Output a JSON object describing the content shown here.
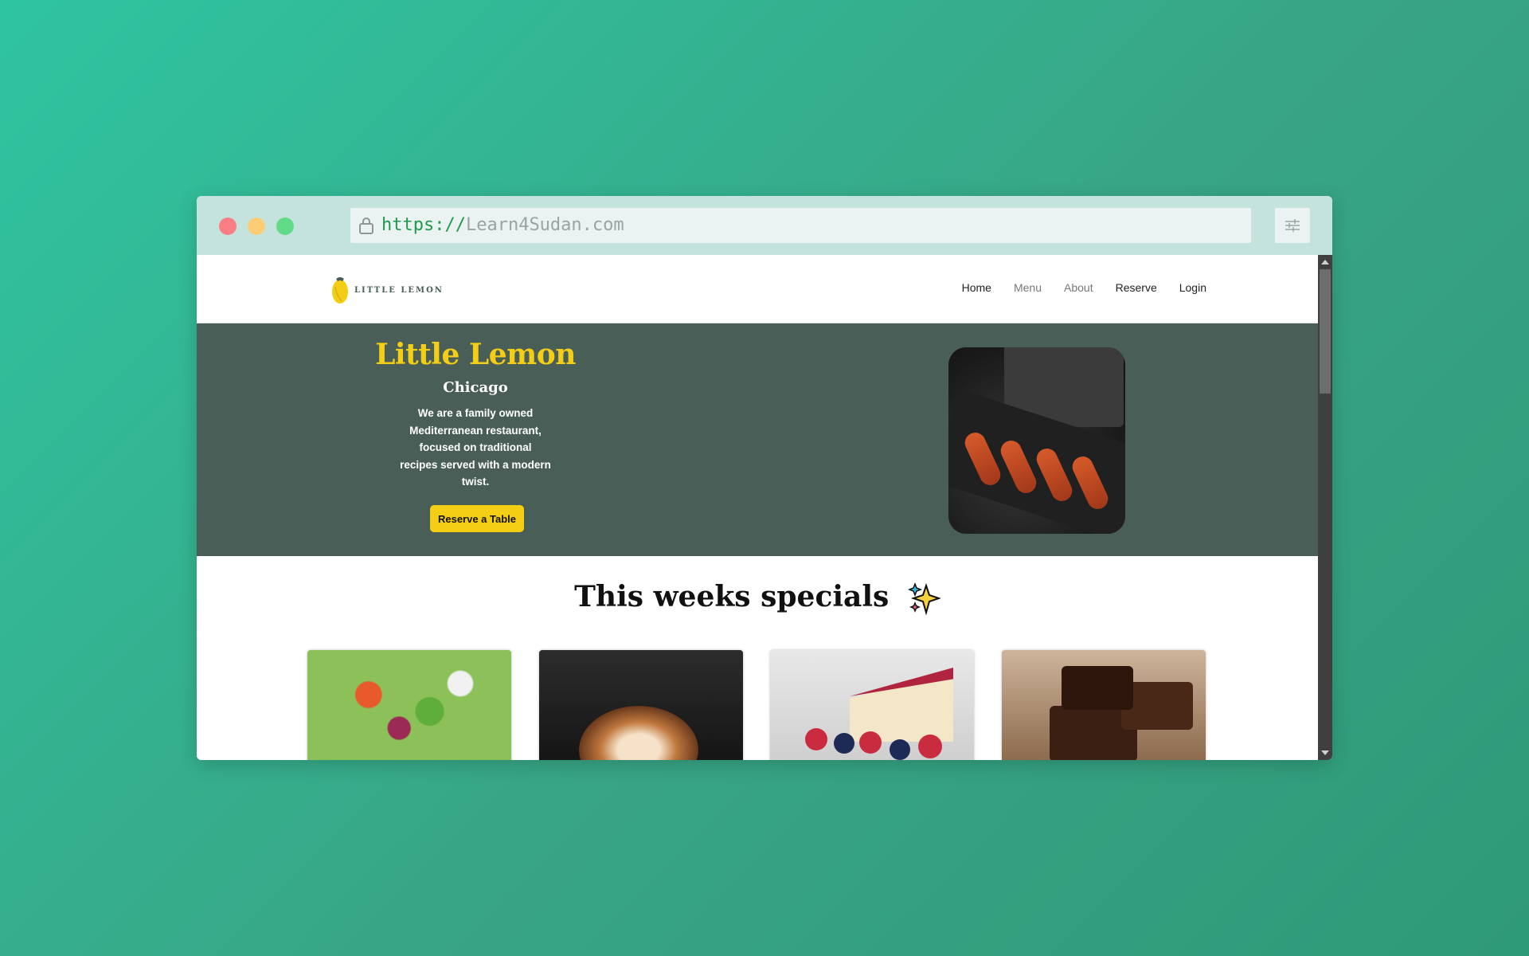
{
  "browser": {
    "url_scheme": "https://",
    "url_host": "Learn4Sudan.com"
  },
  "site": {
    "logo_text": "LITTLE LEMON",
    "nav": [
      {
        "label": "Home"
      },
      {
        "label": "Menu"
      },
      {
        "label": "About"
      },
      {
        "label": "Reserve"
      },
      {
        "label": "Login"
      }
    ]
  },
  "hero": {
    "title": "Little Lemon",
    "subtitle": "Chicago",
    "description": "We are a family owned Mediterranean restaurant, focused on traditional recipes served with a modern twist.",
    "button_label": "Reserve a Table"
  },
  "specials": {
    "title": "This weeks specials"
  },
  "colors": {
    "primary_green": "#495e57",
    "primary_yellow": "#f4ce14",
    "page_gradient": "#2fc4a0"
  },
  "icons": [
    "lock-icon",
    "settings-sliders-icon",
    "lemon-logo-icon",
    "sparkles-icon"
  ]
}
